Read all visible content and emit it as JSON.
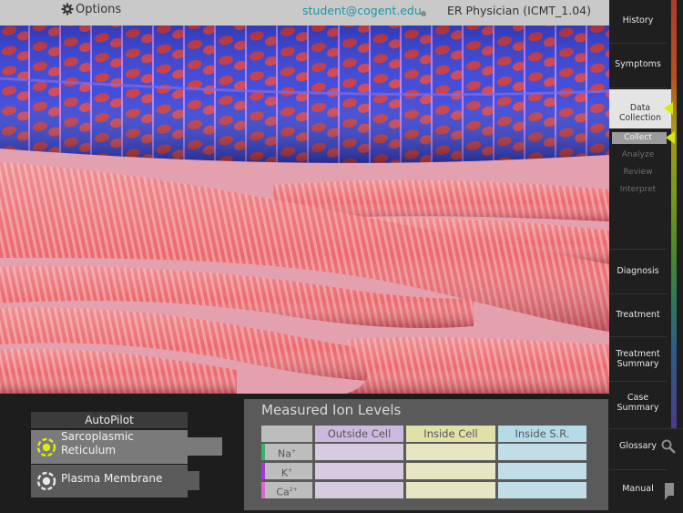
{
  "topbar": {
    "options_label": "Options",
    "user_email": "student@cogent.edu",
    "case_title": "ER Physician (ICMT_1.04)"
  },
  "nav": {
    "history": "History",
    "symptoms": "Symptoms",
    "data_collection": "Data Collection",
    "collect": "Collect",
    "analyze": "Analyze",
    "review": "Review",
    "interpret": "Interpret",
    "diagnosis": "Diagnosis",
    "treatment": "Treatment",
    "treatment_summary_1": "Treatment",
    "treatment_summary_2": "Summary",
    "case_summary_1": "Case",
    "case_summary_2": "Summary",
    "glossary": "Glossary",
    "manual": "Manual"
  },
  "autopilot": {
    "header": "AutoPilot",
    "items": [
      {
        "line1": "Sarcoplasmic",
        "line2": "Reticulum",
        "selected": true
      },
      {
        "line1": "Plasma Membrane",
        "selected": false
      }
    ]
  },
  "ion_table": {
    "title": "Measured Ion Levels",
    "columns": [
      "Outside Cell",
      "Inside Cell",
      "Inside S.R."
    ],
    "rows": [
      {
        "ion": "Na",
        "charge": "+",
        "marker_color": "#3bb36a",
        "values": [
          "",
          "",
          ""
        ]
      },
      {
        "ion": "K",
        "charge": "+",
        "marker_color": "#a43ad2",
        "values": [
          "",
          "",
          ""
        ]
      },
      {
        "ion": "Ca",
        "charge": "2+",
        "marker_color": "#d86acb",
        "values": [
          "",
          "",
          ""
        ]
      }
    ]
  },
  "colors": {
    "accent_yellow": "#d8e80b",
    "email_teal": "#1796a8"
  }
}
